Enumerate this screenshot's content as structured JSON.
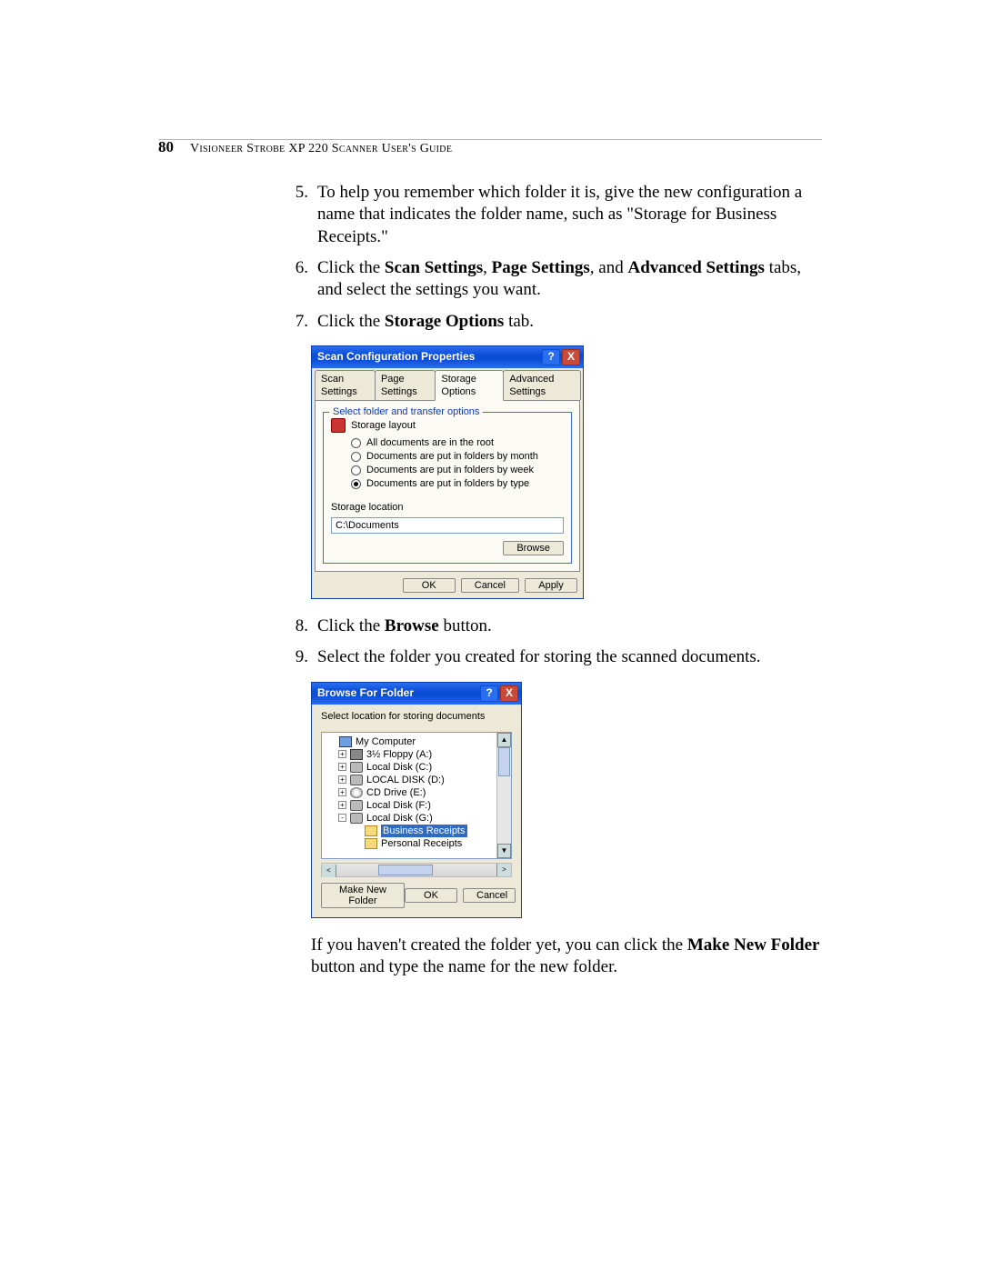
{
  "header": {
    "page_number": "80",
    "title": "Visioneer Strobe XP 220 Scanner User's Guide"
  },
  "steps": {
    "five_num": "5.",
    "five": "To help you remember which folder it is, give the new configuration a name that indicates the folder name, such as \"Storage for Business Receipts.\"",
    "six_num": "6.",
    "six_pre": "Click the ",
    "six_b1": "Scan Settings",
    "six_mid1": ", ",
    "six_b2": "Page Settings",
    "six_mid2": ", and ",
    "six_b3": "Advanced Settings",
    "six_post": " tabs, and select the settings you want.",
    "seven_num": "7.",
    "seven_pre": "Click the ",
    "seven_b": "Storage Options",
    "seven_post": " tab.",
    "eight_num": "8.",
    "eight_pre": "Click the ",
    "eight_b": "Browse",
    "eight_post": " button.",
    "nine_num": "9.",
    "nine": "Select the folder you created for storing the scanned documents.",
    "follow_pre": "If you haven't created the folder yet, you can click the ",
    "follow_b": "Make New Folder",
    "follow_post": " button and type the name for the new folder."
  },
  "dialog1": {
    "title": "Scan Configuration Properties",
    "help": "?",
    "close": "X",
    "tabs": {
      "scan": "Scan Settings",
      "page": "Page Settings",
      "storage": "Storage Options",
      "adv": "Advanced Settings"
    },
    "group_legend": "Select folder and transfer options",
    "layout_label": "Storage layout",
    "radios": {
      "root": "All documents are in the root",
      "month": "Documents are put in folders by month",
      "week": "Documents are put in folders by week",
      "type": "Documents are put in folders by type"
    },
    "loc_label": "Storage location",
    "loc_value": "C:\\Documents",
    "browse": "Browse",
    "ok": "OK",
    "cancel": "Cancel",
    "apply": "Apply"
  },
  "dialog2": {
    "title": "Browse For Folder",
    "help": "?",
    "close": "X",
    "instruction": "Select location for storing documents",
    "tree": {
      "my_computer": "My Computer",
      "floppy": "3½ Floppy (A:)",
      "c": "Local Disk (C:)",
      "d": "LOCAL DISK (D:)",
      "e": "CD Drive (E:)",
      "f": "Local Disk (F:)",
      "g": "Local Disk (G:)",
      "business": "Business Receipts",
      "personal": "Personal Receipts",
      "plus": "+",
      "minus": "-"
    },
    "make_new": "Make New Folder",
    "ok": "OK",
    "cancel": "Cancel",
    "scroll": {
      "up": "▲",
      "down": "▼",
      "left": "<",
      "right": ">"
    }
  }
}
